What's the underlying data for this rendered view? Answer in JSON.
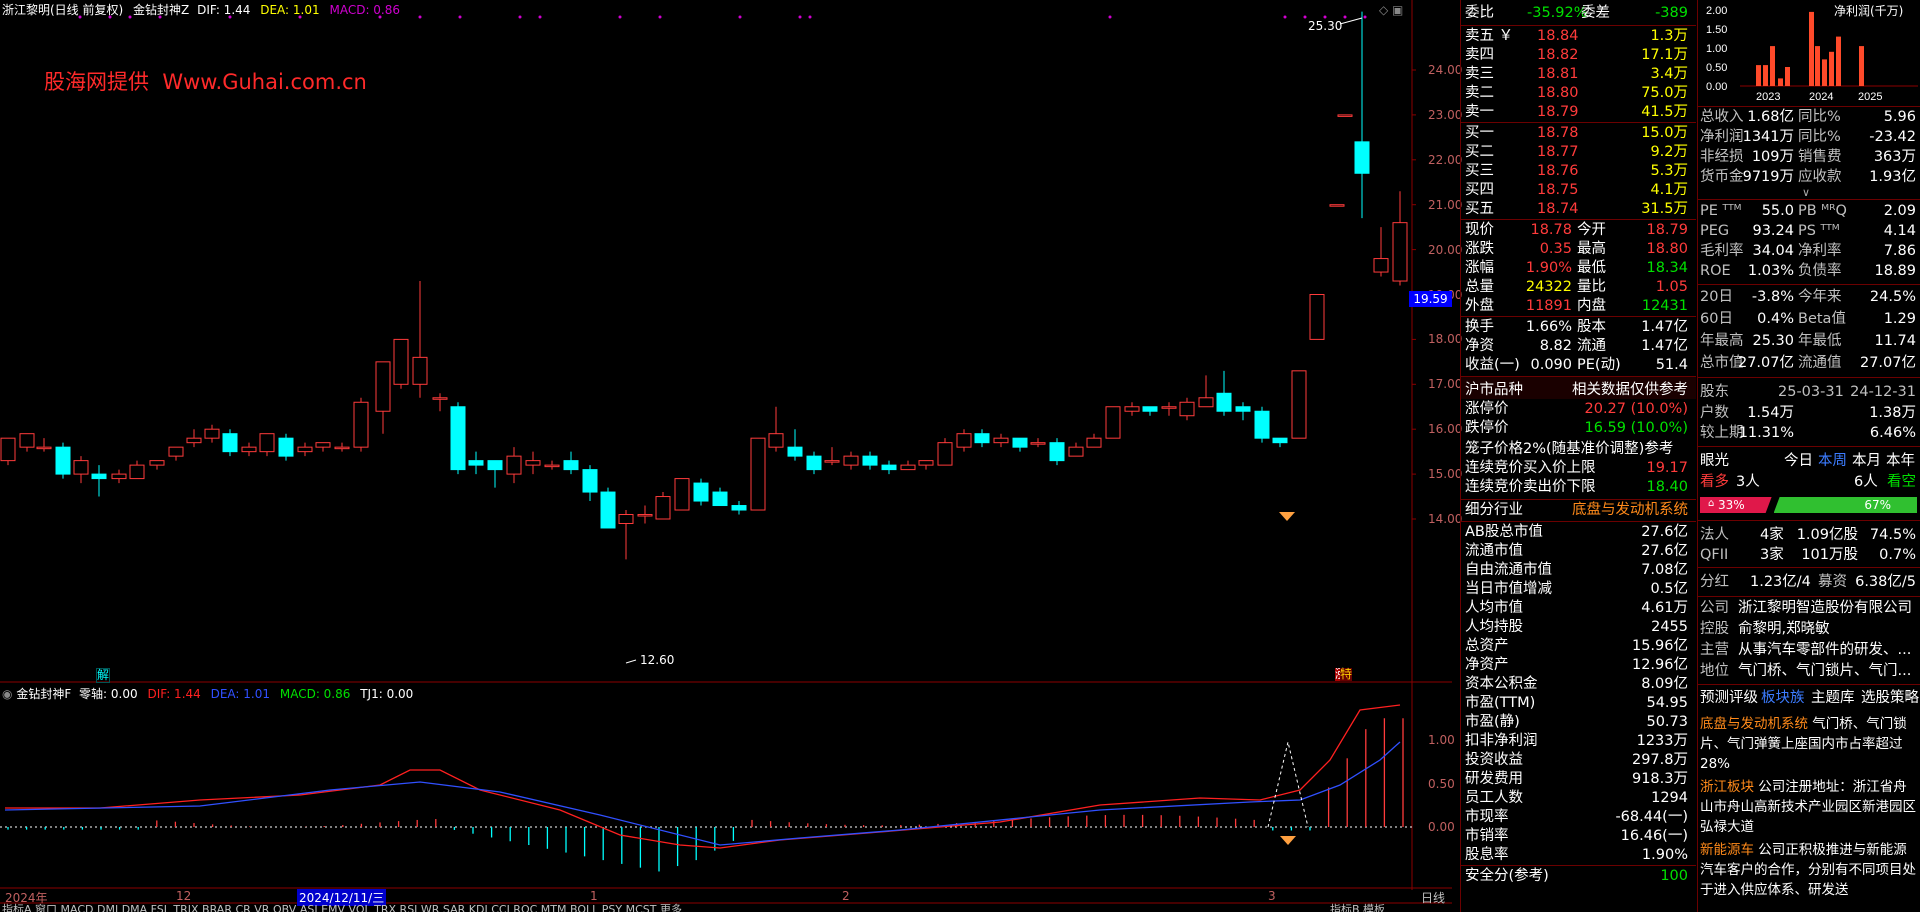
{
  "title_bar": {
    "stock_name": "浙江黎明(日线 前复权)",
    "indicator_name": "金钻封神Z",
    "dif_label": "DIF: 1.44",
    "dea_label": "DEA: 1.01",
    "macd_label": "MACD: 0.86"
  },
  "watermark": "股海网提供  Www.Guhai.com.cn",
  "price_axis": [
    "24.00",
    "23.00",
    "22.00",
    "21.00",
    "20.00",
    "19.00",
    "18.00",
    "17.00",
    "16.00",
    "15.00",
    "14.00"
  ],
  "current_price_tag": "19.59",
  "high_tag": "25.30",
  "low_tag": "12.60",
  "marker_jie": "解",
  "marker_zhang": "涨",
  "marker_te": "特",
  "sub_chart": {
    "name": "金钻封神F",
    "zero_label": "零轴: 0.00",
    "dif_label": "DIF: 1.44",
    "dea_label": "DEA: 1.01",
    "macd_label": "MACD: 0.86",
    "tj1_label": "TJ1: 0.00",
    "axis": [
      "1.00",
      "0.50",
      "0.00"
    ]
  },
  "date_axis": {
    "year": "2024年",
    "m12": "12",
    "cursor_date": "2024/12/11/三",
    "m1": "1",
    "m2": "2",
    "m3": "3"
  },
  "period_label": "日线",
  "bottom_tabs": "指标A  窗口  MACD  DMI  DMA  FSL  TRIX  BRAR  CR  VR  OBV  ASI  EMV  VOL  TRX  RSI  WR  SAR  KDJ  CCI  ROC  MTM  BOLL  PSY  MCST  更多",
  "bottom_right": "指标B  模板",
  "quote": {
    "weibi_label": "委比",
    "weibi_value": "-35.92%",
    "weicha_label": "委差",
    "weicha_value": "-389",
    "asks": [
      {
        "label": "卖五 ￥",
        "price": "18.84",
        "vol": "1.3万"
      },
      {
        "label": "卖四",
        "price": "18.82",
        "vol": "17.1万"
      },
      {
        "label": "卖三",
        "price": "18.81",
        "vol": "3.4万"
      },
      {
        "label": "卖二",
        "price": "18.80",
        "vol": "75.0万"
      },
      {
        "label": "卖一",
        "price": "18.79",
        "vol": "41.5万"
      }
    ],
    "bids": [
      {
        "label": "买一",
        "price": "18.78",
        "vol": "15.0万"
      },
      {
        "label": "买二",
        "price": "18.77",
        "vol": "9.2万"
      },
      {
        "label": "买三",
        "price": "18.76",
        "vol": "5.3万"
      },
      {
        "label": "买四",
        "price": "18.75",
        "vol": "4.1万"
      },
      {
        "label": "买五",
        "price": "18.74",
        "vol": "31.5万"
      }
    ],
    "stats": [
      {
        "l1": "现价",
        "v1": "18.78",
        "l2": "今开",
        "v2": "18.79"
      },
      {
        "l1": "涨跌",
        "v1": "0.35",
        "l2": "最高",
        "v2": "18.80"
      },
      {
        "l1": "涨幅",
        "v1": "1.90%",
        "l2": "最低",
        "v2": "18.34"
      },
      {
        "l1": "总量",
        "v1": "24322",
        "l2": "量比",
        "v2": "1.05"
      },
      {
        "l1": "外盘",
        "v1": "11891",
        "l2": "内盘",
        "v2": "12431"
      }
    ],
    "stats2": [
      {
        "l1": "换手",
        "v1": "1.66%",
        "l2": "股本",
        "v2": "1.47亿"
      },
      {
        "l1": "净资",
        "v1": "8.82",
        "l2": "流通",
        "v2": "1.47亿"
      },
      {
        "l1": "收益(一)",
        "v1": "0.090",
        "l2": "PE(动)",
        "v2": "51.4"
      }
    ],
    "market_kind": "沪市品种",
    "ref_note": "相关数据仅供参考",
    "limit_up_label": "涨停价",
    "limit_up": "20.27 (10.0%)",
    "limit_down_label": "跌停价",
    "limit_down": "16.59 (10.0%)",
    "cage_label": "笼子价格2%(随基准价调整)参考",
    "buy_cap_label": "连续竞价买入价上限",
    "buy_cap": "19.17",
    "sell_floor_label": "连续竞价卖出价下限",
    "sell_floor": "18.40",
    "industry_label": "细分行业",
    "industry_value": "底盘与发动机系统",
    "fundamentals": [
      {
        "label": "AB股总市值",
        "value": "27.6亿"
      },
      {
        "label": "流通市值",
        "value": "27.6亿"
      },
      {
        "label": "自由流通市值",
        "value": "7.08亿"
      },
      {
        "label": "当日市值增减",
        "value": "0.5亿"
      },
      {
        "label": "人均市值",
        "value": "4.61万"
      },
      {
        "label": "人均持股",
        "value": "2455"
      },
      {
        "label": "总资产",
        "value": "15.96亿"
      },
      {
        "label": "净资产",
        "value": "12.96亿"
      },
      {
        "label": "资本公积金",
        "value": "8.09亿"
      },
      {
        "label": "市盈(TTM)",
        "value": "54.95"
      },
      {
        "label": "市盈(静)",
        "value": "50.73"
      },
      {
        "label": "扣非净利润",
        "value": "1233万"
      },
      {
        "label": "投资收益",
        "value": "297.8万"
      },
      {
        "label": "研发费用",
        "value": "918.3万"
      },
      {
        "label": "员工人数",
        "value": "1294"
      },
      {
        "label": "市现率",
        "value": "-68.44(一)"
      },
      {
        "label": "市销率",
        "value": "16.46(一)"
      },
      {
        "label": "股息率",
        "value": "1.90%"
      }
    ],
    "safety_label": "安全分(参考)",
    "safety_value": "100"
  },
  "finance": {
    "chart_title": "净利润(千万)",
    "chart_axis": [
      "2.00",
      "1.50",
      "1.00",
      "0.50",
      "0.00"
    ],
    "chart_years": [
      "2023",
      "2024",
      "2025"
    ],
    "rows": [
      {
        "l1": "总收入",
        "v1": "1.68亿",
        "l2": "同比%",
        "v2": "5.96"
      },
      {
        "l1": "净利润",
        "v1": "1341万",
        "l2": "同比%",
        "v2": "-23.42"
      },
      {
        "l1": "非经损",
        "v1": "109万",
        "l2": "销售费",
        "v2": "363万"
      },
      {
        "l1": "货币金",
        "v1": "9719万",
        "l2": "应收款",
        "v2": "1.93亿"
      }
    ],
    "ratios": [
      {
        "l1": "PE ᵀᵀᴹ",
        "v1": "55.0",
        "l2": "PB ᴹᴿQ",
        "v2": "2.09"
      },
      {
        "l1": "PEG",
        "v1": "93.24",
        "l2": "PS ᵀᵀᴹ",
        "v2": "4.14"
      },
      {
        "l1": "毛利率",
        "v1": "34.04",
        "l2": "净利率",
        "v2": "7.86"
      },
      {
        "l1": "ROE",
        "v1": "1.03%",
        "l2": "负债率",
        "v2": "18.89"
      }
    ],
    "perf": [
      {
        "l1": "20日",
        "v1": "-3.8%",
        "l2": "今年来",
        "v2": "24.5%"
      },
      {
        "l1": "60日",
        "v1": "0.4%",
        "l2": "Beta值",
        "v2": "1.29"
      },
      {
        "l1": "年最高",
        "v1": "25.30",
        "l2": "年最低",
        "v2": "11.74"
      },
      {
        "l1": "总市值",
        "v1": "27.07亿",
        "l2": "流通值",
        "v2": "27.07亿"
      }
    ],
    "holders_header": {
      "label": "股东",
      "d1": "25-03-31",
      "d2": "24-12-31"
    },
    "holders": [
      {
        "label": "户数",
        "v1": "1.54万",
        "v2": "1.38万"
      },
      {
        "label": "较上期",
        "v1": "11.31%",
        "v2": "6.46%"
      }
    ],
    "view_label": "眼光",
    "view_tabs": [
      "今日",
      "本周",
      "本月",
      "本年"
    ],
    "bull_label": "看多",
    "bull_count": "3人",
    "bear_count": "6人",
    "bear_label": "看空",
    "bull_pct": 33,
    "bull_pct_text": "33%",
    "bear_pct_text": "67%",
    "inst": [
      {
        "label": "法人",
        "v1": "4家",
        "v2": "1.09亿股",
        "v3": "74.5%"
      },
      {
        "label": "QFII",
        "v1": "3家",
        "v2": "101万股",
        "v3": "0.7%"
      }
    ],
    "dividend": {
      "label": "分红",
      "value": "1.23亿/4",
      "label2": "募资",
      "value2": "6.38亿/5"
    },
    "company": [
      {
        "label": "公司",
        "value": "浙江黎明智造股份有限公司"
      },
      {
        "label": "控股",
        "value": "俞黎明,郑晓敏"
      },
      {
        "label": "主营",
        "value": "从事汽车零部件的研发、..."
      },
      {
        "label": "地位",
        "value": "气门桥、气门锁片、气门..."
      }
    ],
    "links": [
      "预测评级",
      "板块族",
      "主题库",
      "选股策略"
    ],
    "notes": [
      {
        "tag": "底盘与发动机系统",
        "text": "气门桥、气门锁片、气门弹簧上座国内市占率超过28%"
      },
      {
        "tag": "浙江板块",
        "text": "公司注册地址：浙江省舟山市舟山高新技术产业园区新港园区弘禄大道"
      },
      {
        "tag": "新能源车",
        "text": "公司正积极推进与新能源汽车客户的合作，分别有不同项目处于进入供应体系、研发送"
      }
    ]
  },
  "colors": {
    "up": "#ff3b3b",
    "down": "#00ffff",
    "dif": "#ff2020",
    "dea": "#3050ff",
    "grid": "#6b0000"
  }
}
